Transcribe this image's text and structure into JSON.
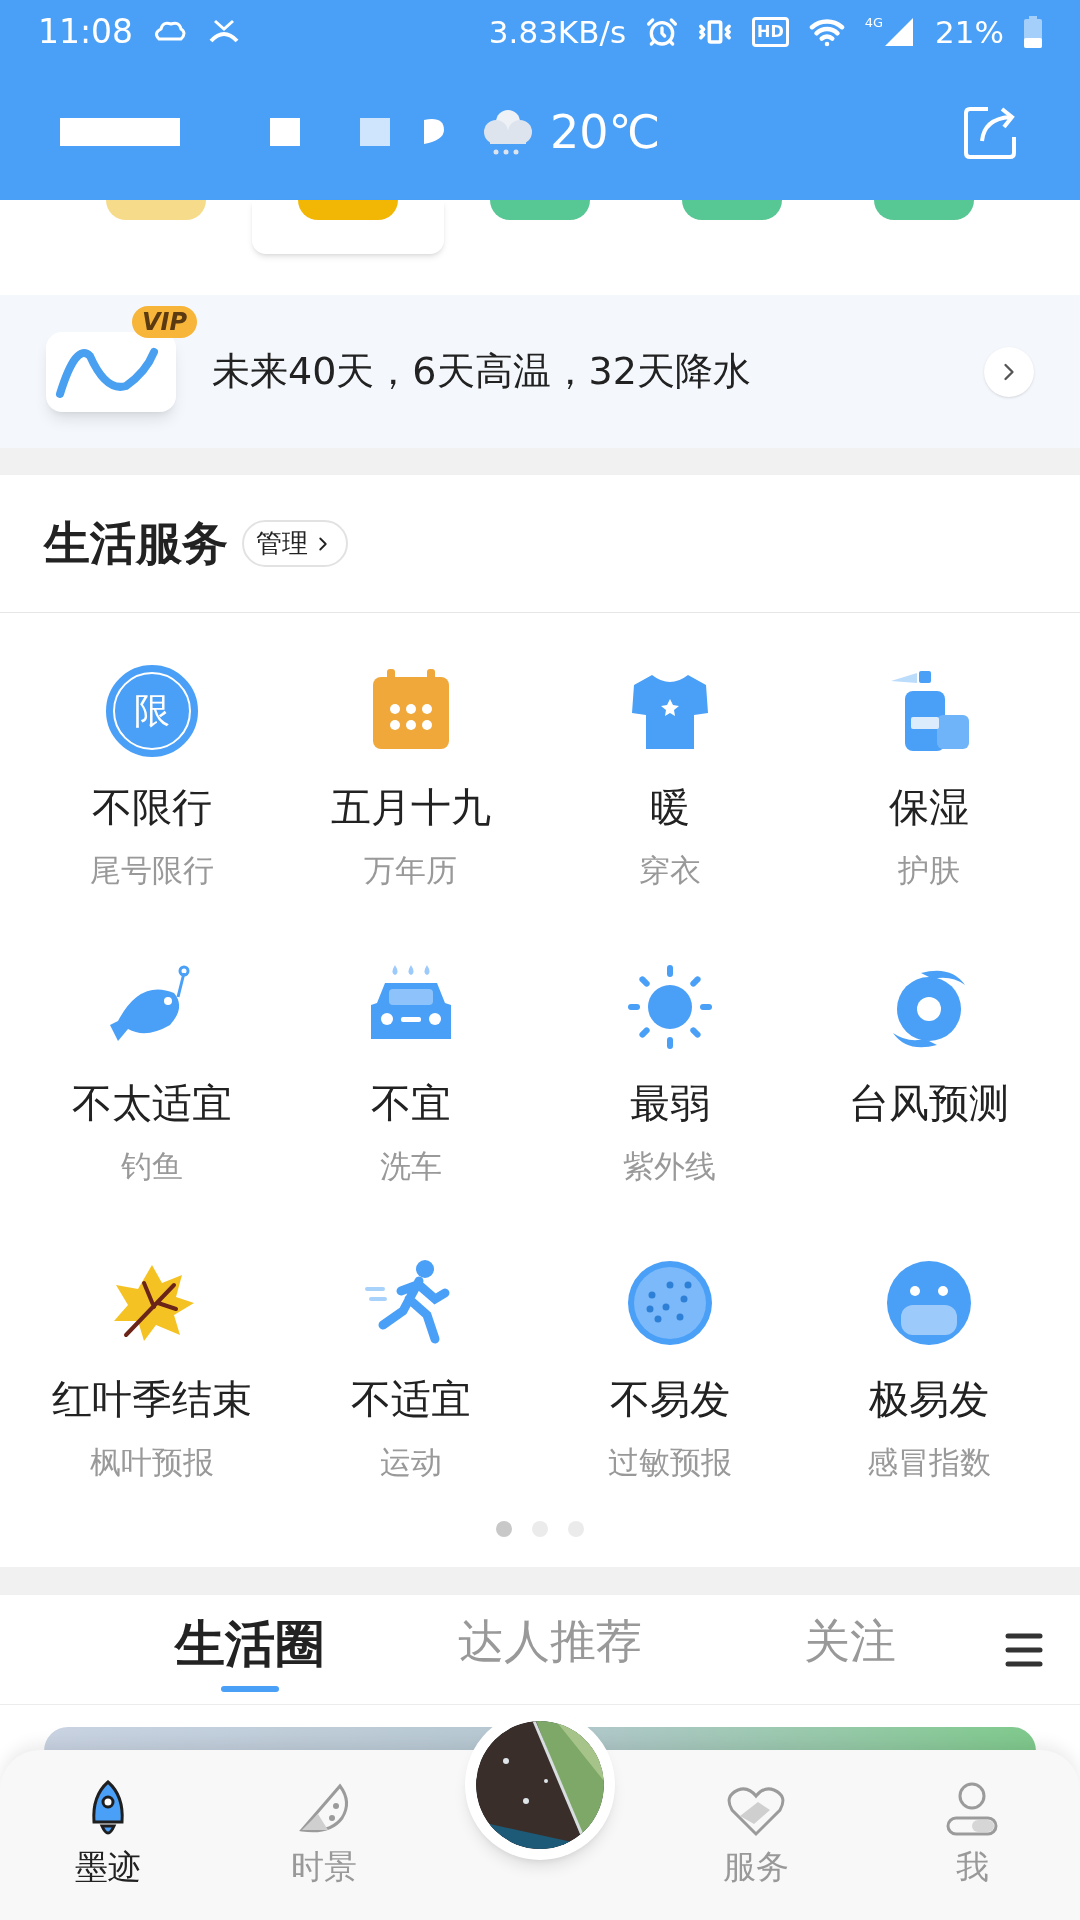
{
  "status_bar": {
    "time": "11:08",
    "speed": "3.83KB/s",
    "hd": "HD",
    "network": "4G",
    "battery": "21%"
  },
  "header": {
    "temperature": "20℃"
  },
  "aqi_pills": [
    {
      "color": "#f6dc8a"
    },
    {
      "color": "#f2b705"
    },
    {
      "color": "#57c794"
    },
    {
      "color": "#57c794"
    },
    {
      "color": "#57c794"
    }
  ],
  "vip_banner": {
    "badge": "VIP",
    "text": "未来40天，6天高温，32天降水"
  },
  "services": {
    "title": "生活服务",
    "manage": "管理",
    "items": [
      {
        "kind": "limit",
        "title": "不限行",
        "subtitle": "尾号限行",
        "glyph": "限"
      },
      {
        "kind": "calendar",
        "title": "五月十九",
        "subtitle": "万年历"
      },
      {
        "kind": "shirt",
        "title": "暖",
        "subtitle": "穿衣"
      },
      {
        "kind": "skincare",
        "title": "保湿",
        "subtitle": "护肤"
      },
      {
        "kind": "fish",
        "title": "不太适宜",
        "subtitle": "钓鱼"
      },
      {
        "kind": "car",
        "title": "不宜",
        "subtitle": "洗车"
      },
      {
        "kind": "sun",
        "title": "最弱",
        "subtitle": "紫外线"
      },
      {
        "kind": "typhoon",
        "title": "台风预测"
      },
      {
        "kind": "leaf",
        "title": "红叶季结束",
        "subtitle": "枫叶预报"
      },
      {
        "kind": "run",
        "title": "不适宜",
        "subtitle": "运动"
      },
      {
        "kind": "pollen",
        "title": "不易发",
        "subtitle": "过敏预报"
      },
      {
        "kind": "mask",
        "title": "极易发",
        "subtitle": "感冒指数"
      }
    ],
    "pages": [
      {
        "selected": true
      },
      {
        "selected": false
      },
      {
        "selected": false
      }
    ]
  },
  "feed_tabs": [
    {
      "label": "生活圈",
      "selected": true
    },
    {
      "label": "达人推荐",
      "selected": false
    },
    {
      "label": "关注",
      "selected": false
    }
  ],
  "bottom_nav": [
    {
      "kind": "rocket",
      "label": "墨迹",
      "selected": true
    },
    {
      "kind": "melon",
      "label": "时景",
      "selected": false
    },
    {
      "kind": "center"
    },
    {
      "kind": "heart",
      "label": "服务",
      "selected": false
    },
    {
      "kind": "person",
      "label": "我",
      "selected": false
    }
  ]
}
